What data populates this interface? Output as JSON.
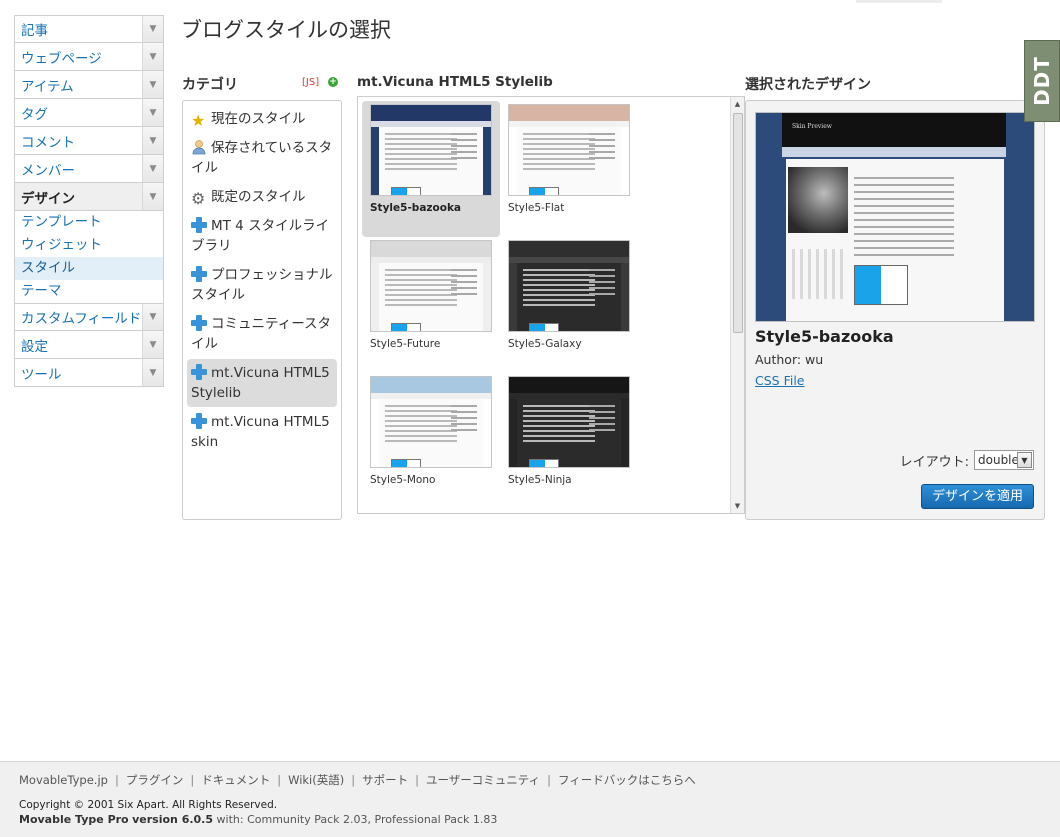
{
  "nav": {
    "items": [
      {
        "label": "記事"
      },
      {
        "label": "ウェブページ"
      },
      {
        "label": "アイテム"
      },
      {
        "label": "タグ"
      },
      {
        "label": "コメント"
      },
      {
        "label": "メンバー"
      },
      {
        "label": "デザイン"
      },
      {
        "label": "カスタムフィールド"
      },
      {
        "label": "設定"
      },
      {
        "label": "ツール"
      }
    ],
    "design_sub": [
      {
        "label": "テンプレート"
      },
      {
        "label": "ウィジェット"
      },
      {
        "label": "スタイル"
      },
      {
        "label": "テーマ"
      }
    ]
  },
  "page": {
    "title": "ブログスタイルの選択"
  },
  "categories": {
    "heading": "カテゴリ",
    "js_label": "[JS]",
    "items": [
      {
        "label": "現在のスタイル",
        "icon": "star-icon"
      },
      {
        "label": "保存されているスタイル",
        "icon": "person-icon"
      },
      {
        "label": "既定のスタイル",
        "icon": "gear-icon"
      },
      {
        "label": "MT 4 スタイルライブラリ",
        "icon": "plus-icon"
      },
      {
        "label": "プロフェッショナルスタイル",
        "icon": "plus-icon"
      },
      {
        "label": "コミュニティースタイル",
        "icon": "plus-icon"
      },
      {
        "label": "mt.Vicuna HTML5 Stylelib",
        "icon": "plus-icon"
      },
      {
        "label": "mt.Vicuna HTML5 skin",
        "icon": "plus-icon"
      }
    ]
  },
  "styles": {
    "heading": "mt.Vicuna HTML5 Stylelib",
    "tiles": [
      {
        "name": "Style5-bazooka",
        "top": "#223866",
        "nav": "#d7dbe5",
        "bg": "#26406e"
      },
      {
        "name": "Style5-Flat",
        "top": "#d7b4a3",
        "nav": "#f2f2f2",
        "bg": "#ffffff"
      },
      {
        "name": "Style5-Future",
        "top": "#d9d9d9",
        "nav": "#ededed",
        "bg": "#efefef"
      },
      {
        "name": "Style5-Galaxy",
        "top": "#2f2f2f",
        "nav": "#474747",
        "bg": "#3a3a3a"
      },
      {
        "name": "Style5-Mono",
        "top": "#a8c8e2",
        "nav": "#f0f0f0",
        "bg": "#ffffff"
      },
      {
        "name": "Style5-Ninja",
        "top": "#161616",
        "nav": "#2a2a2a",
        "bg": "#252525"
      }
    ]
  },
  "selected": {
    "heading": "選択されたデザイン",
    "preview_title": "Skin Preview",
    "name": "Style5-bazooka",
    "author": "Author: wu",
    "css_link": "CSS File",
    "layout_label": "レイアウト:",
    "layout_value": "double",
    "apply_label": "デザインを適用"
  },
  "badge": {
    "text": "DDT"
  },
  "footer": {
    "links": [
      {
        "label": "MovableType.jp"
      },
      {
        "label": "プラグイン"
      },
      {
        "label": "ドキュメント"
      },
      {
        "label": "Wiki(英語)"
      },
      {
        "label": "サポート"
      },
      {
        "label": "ユーザーコミュニティ"
      },
      {
        "label": "フィードバックはこちらへ"
      }
    ],
    "copyright": "Copyright © 2001 Six Apart. All Rights Reserved.",
    "product": "Movable Type Pro",
    "version": "version 6.0.5",
    "with": "with: ",
    "packs": "Community Pack 2.03, Professional Pack 1.83"
  }
}
